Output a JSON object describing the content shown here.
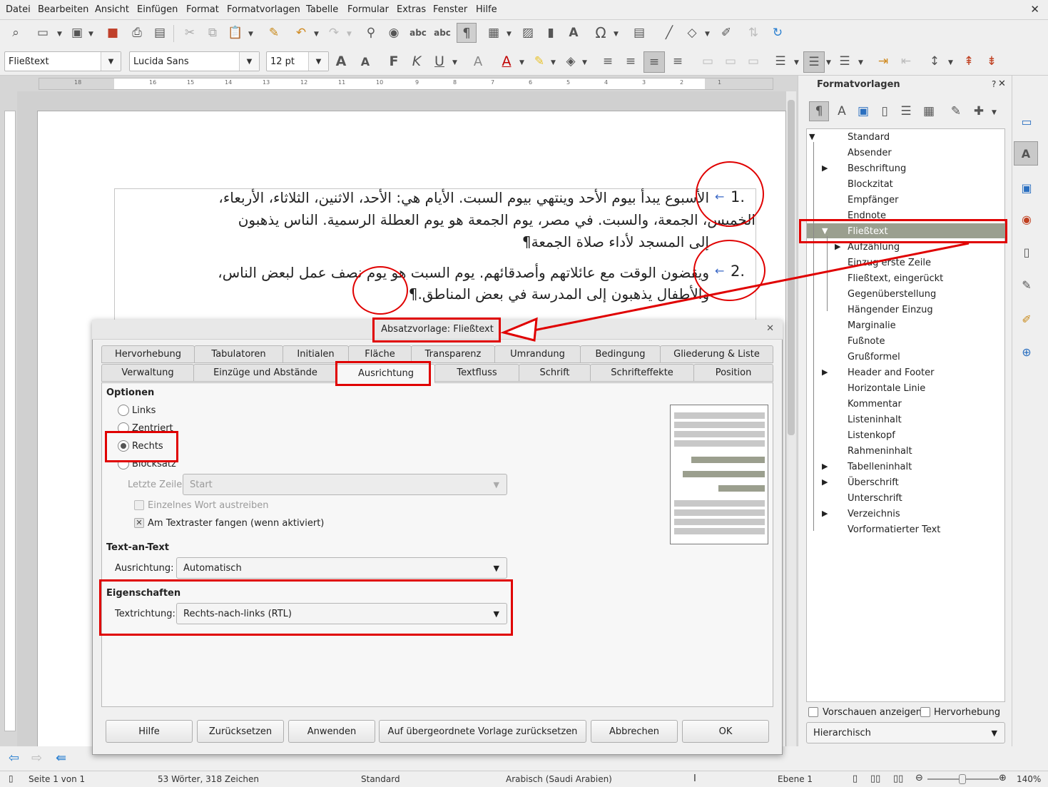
{
  "menu": [
    "Datei",
    "Bearbeiten",
    "Ansicht",
    "Einfügen",
    "Format",
    "Formatvorlagen",
    "Tabelle",
    "Formular",
    "Extras",
    "Fenster",
    "Hilfe"
  ],
  "toolbar": {
    "paragraph_style": "Fließtext",
    "font_name": "Lucida Sans",
    "font_size": "12 pt",
    "bold": "F",
    "italic": "K",
    "underline": "U"
  },
  "ruler_numbers": [
    "18",
    "16",
    "15",
    "14",
    "13",
    "12",
    "11",
    "10",
    "9",
    "8",
    "7",
    "6",
    "5",
    "4",
    "3",
    "2",
    "1"
  ],
  "document": {
    "item1_number": "1.",
    "item1_lines": [
      "الأسبوع يبدأ بيوم الأحد وينتهي بيوم السبت. الأيام هي: الأحد، الاثنين، الثلاثاء، الأربعاء،",
      "الخميس، الجمعة، والسبت. في مصر، يوم الجمعة هو يوم العطلة الرسمية. الناس يذهبون",
      "إلى المسجد لأداء صلاة الجمعة¶"
    ],
    "item2_number": "2.",
    "item2_lines": [
      "ويقضون الوقت مع عائلاتهم وأصدقائهم. يوم السبت هو يوم نصف عمل لبعض الناس،",
      "والأطفال يذهبون إلى المدرسة في بعض المناطق.¶"
    ]
  },
  "sidebar": {
    "title": "Formatvorlagen",
    "help": "?",
    "styles": [
      "Standard",
      "Absender",
      "Beschriftung",
      "Blockzitat",
      "Empfänger",
      "Endnote",
      "Fließtext",
      "Aufzählung",
      "Einzug erste Zeile",
      "Fließtext, eingerückt",
      "Gegenüberstellung",
      "Hängender Einzug",
      "Marginalie",
      "Fußnote",
      "Grußformel",
      "Header and Footer",
      "Horizontale Linie",
      "Kommentar",
      "Listeninhalt",
      "Listenkopf",
      "Rahmeninhalt",
      "Tabelleninhalt",
      "Überschrift",
      "Unterschrift",
      "Verzeichnis",
      "Vorformatierter Text"
    ],
    "selected": "Fließtext",
    "show_previews": "Vorschauen anzeigen",
    "highlight": "Hervorhebung",
    "view_mode": "Hierarchisch"
  },
  "dialog": {
    "title": "Absatzvorlage: Fließtext",
    "tabs_row1": [
      "Hervorhebung",
      "Tabulatoren",
      "Initialen",
      "Fläche",
      "Transparenz",
      "Umrandung",
      "Bedingung",
      "Gliederung & Liste"
    ],
    "tabs_row2": [
      "Verwaltung",
      "Einzüge und Abstände",
      "Ausrichtung",
      "Textfluss",
      "Schrift",
      "Schrifteffekte",
      "Position"
    ],
    "active_tab": "Ausrichtung",
    "options_heading": "Optionen",
    "radio_left": "Links",
    "radio_center": "Zentriert",
    "radio_right": "Rechts",
    "radio_justify": "Blocksatz",
    "last_line_label": "Letzte Zeile:",
    "last_line_value": "Start",
    "expand_word": "Einzelnes Wort austreiben",
    "snap_grid": "Am Textraster fangen (wenn aktiviert)",
    "text_to_text_heading": "Text-an-Text",
    "alignment_label": "Ausrichtung:",
    "alignment_value": "Automatisch",
    "properties_heading": "Eigenschaften",
    "direction_label": "Textrichtung:",
    "direction_value": "Rechts-nach-links (RTL)",
    "buttons": {
      "help": "Hilfe",
      "reset": "Zurücksetzen",
      "apply": "Anwenden",
      "reset_parent": "Auf übergeordnete Vorlage zurücksetzen",
      "cancel": "Abbrechen",
      "ok": "OK"
    }
  },
  "status": {
    "page": "Seite 1 von 1",
    "words": "53 Wörter, 318 Zeichen",
    "page_style": "Standard",
    "language": "Arabisch (Saudi Arabien)",
    "level": "Ebene 1",
    "zoom": "140%"
  },
  "colors": {
    "annotation_red": "#e00000",
    "selection": "#9a9f8f"
  }
}
